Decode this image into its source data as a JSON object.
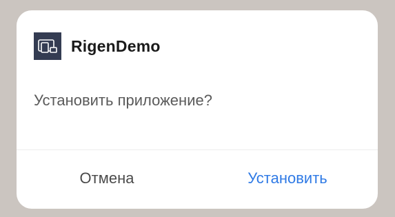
{
  "dialog": {
    "app_name": "RigenDemo",
    "app_icon": "devices-icon",
    "question": "Установить приложение?",
    "cancel_label": "Отмена",
    "install_label": "Установить"
  },
  "colors": {
    "backdrop": "#cbc5c0",
    "dialog_bg": "#ffffff",
    "icon_bg": "#343c52",
    "accent": "#2f7ae5",
    "text_secondary": "#5a5a5a"
  }
}
